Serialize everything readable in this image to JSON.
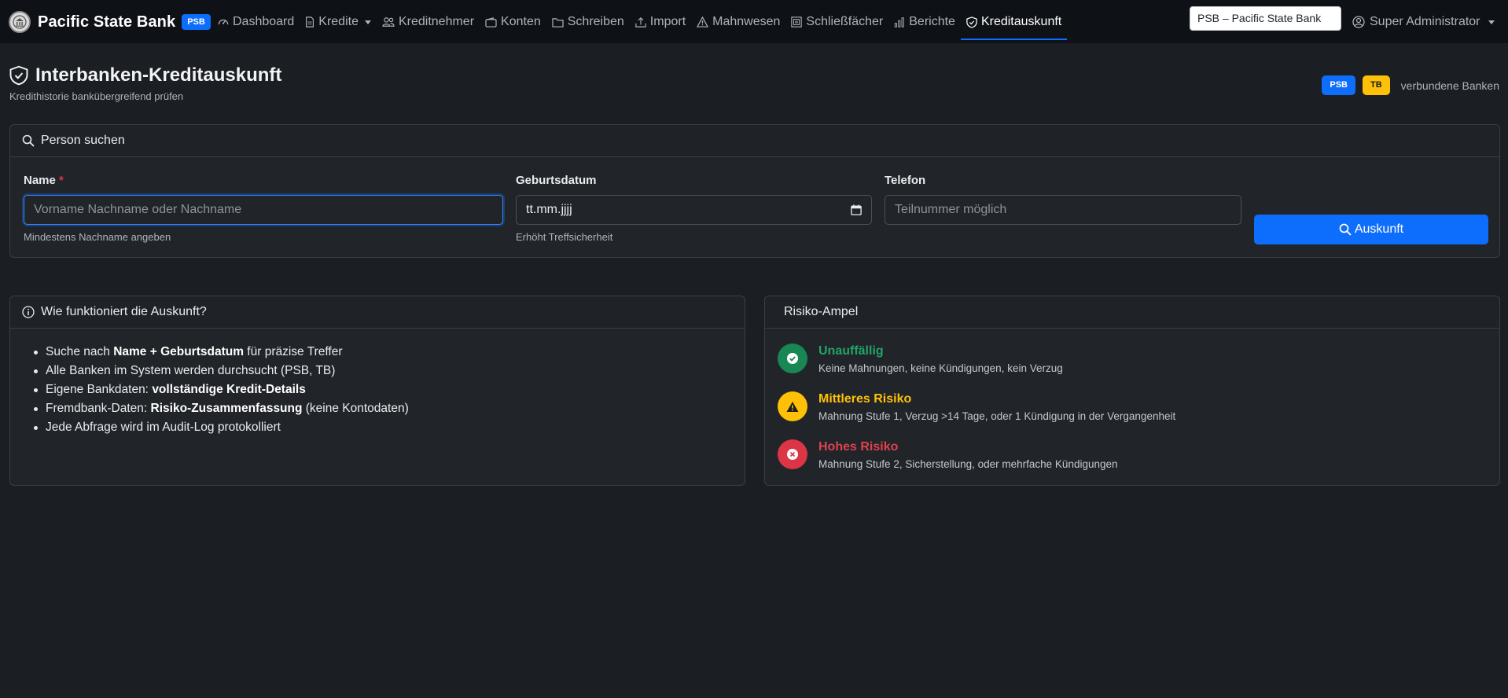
{
  "navbar": {
    "brand_name": "Pacific State Bank",
    "brand_badge": "PSB",
    "items": [
      {
        "label": "Dashboard",
        "icon": "speedometer-icon"
      },
      {
        "label": "Kredite",
        "icon": "document-icon",
        "dropdown": true
      },
      {
        "label": "Kreditnehmer",
        "icon": "people-icon"
      },
      {
        "label": "Konten",
        "icon": "wallet-icon"
      },
      {
        "label": "Schreiben",
        "icon": "folder-icon"
      },
      {
        "label": "Import",
        "icon": "upload-icon"
      },
      {
        "label": "Mahnwesen",
        "icon": "warning-icon"
      },
      {
        "label": "Schließfächer",
        "icon": "safe-icon"
      },
      {
        "label": "Berichte",
        "icon": "bar-chart-icon"
      },
      {
        "label": "Kreditauskunft",
        "icon": "shield-check-icon",
        "active": true
      }
    ],
    "bank_select_value": "PSB – Pacific State Bank",
    "user_label": "Super Administrator"
  },
  "header": {
    "title": "Interbanken-Kreditauskunft",
    "subtitle": "Kredithistorie bankübergreifend prüfen",
    "banks": [
      "PSB",
      "TB"
    ],
    "banks_label": "verbundene Banken"
  },
  "search": {
    "card_title": "Person suchen",
    "name_label": "Name",
    "name_required_mark": "*",
    "name_placeholder": "Vorname Nachname oder Nachname",
    "name_help": "Mindestens Nachname angeben",
    "dob_label": "Geburtsdatum",
    "dob_placeholder": "tt.mm.jjjj",
    "dob_help": "Erhöht Treffsicherheit",
    "phone_label": "Telefon",
    "phone_placeholder": "Teilnummer möglich",
    "submit_label": "Auskunft"
  },
  "info": {
    "card_title": "Wie funktioniert die Auskunft?",
    "items": [
      {
        "pre": "Suche nach ",
        "bold": "Name + Geburtsdatum",
        "post": " für präzise Treffer"
      },
      {
        "pre": "Alle Banken im System werden durchsucht (PSB, TB)",
        "bold": "",
        "post": ""
      },
      {
        "pre": "Eigene Bankdaten: ",
        "bold": "vollständige Kredit-Details",
        "post": ""
      },
      {
        "pre": "Fremdbank-Daten: ",
        "bold": "Risiko-Zusammenfassung",
        "post": " (keine Kontodaten)"
      },
      {
        "pre": "Jede Abfrage wird im Audit-Log protokolliert",
        "bold": "",
        "post": ""
      }
    ]
  },
  "risk": {
    "card_title": "Risiko-Ampel",
    "levels": [
      {
        "title": "Unauffällig",
        "desc": "Keine Mahnungen, keine Kündigungen, kein Verzug",
        "color": "#198754",
        "title_color": "#20a466",
        "icon": "check-circle-icon"
      },
      {
        "title": "Mittleres Risiko",
        "desc": "Mahnung Stufe 1, Verzug >14 Tage, oder 1 Kündigung in der Vergangenheit",
        "color": "#ffc107",
        "title_color": "#ffc107",
        "icon": "warning-triangle-icon"
      },
      {
        "title": "Hohes Risiko",
        "desc": "Mahnung Stufe 2, Sicherstellung, oder mehrfache Kündigungen",
        "color": "#dc3545",
        "title_color": "#e0404f",
        "icon": "x-circle-icon"
      }
    ]
  },
  "colors": {
    "background": "#1b1e22",
    "navbar": "#0e1116",
    "primary": "#0d6efd",
    "warning": "#ffc107",
    "success": "#198754",
    "danger": "#dc3545"
  }
}
